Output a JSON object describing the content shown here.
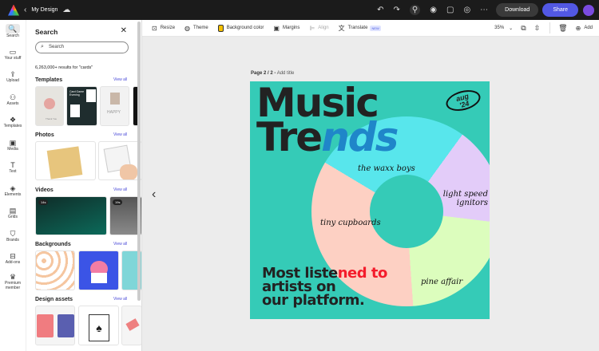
{
  "topbar": {
    "title": "My Design",
    "download": "Download",
    "share": "Share"
  },
  "rail": [
    {
      "icon": "search-icon",
      "glyph": "🔍",
      "label": "Search"
    },
    {
      "icon": "folder-icon",
      "glyph": "▭",
      "label": "Your stuff"
    },
    {
      "icon": "upload-icon",
      "glyph": "⇪",
      "label": "Upload"
    },
    {
      "icon": "assets-icon",
      "glyph": "⚇",
      "label": "Assets"
    },
    {
      "icon": "templates-icon",
      "glyph": "❖",
      "label": "Templates"
    },
    {
      "icon": "media-icon",
      "glyph": "▣",
      "label": "Media"
    },
    {
      "icon": "text-icon",
      "glyph": "T",
      "label": "Text"
    },
    {
      "icon": "elements-icon",
      "glyph": "◈",
      "label": "Elements"
    },
    {
      "icon": "grids-icon",
      "glyph": "▤",
      "label": "Grids"
    },
    {
      "icon": "brands-icon",
      "glyph": "⛉",
      "label": "Brands"
    },
    {
      "icon": "addons-icon",
      "glyph": "⊟",
      "label": "Add-ons"
    },
    {
      "icon": "premium-icon",
      "glyph": "♛",
      "label": "Premium member"
    }
  ],
  "panel": {
    "title": "Search",
    "search_placeholder": "Search",
    "results": "6,263,000+ results for \"cards\"",
    "view_all": "View all",
    "sections": [
      "Templates",
      "Photos",
      "Videos",
      "Backgrounds",
      "Design assets"
    ],
    "video_durations": [
      "14s",
      "19s"
    ],
    "template_text": [
      "Thank You",
      "Card Game Evening",
      "HAPPY"
    ]
  },
  "toolbar": {
    "resize": "Resize",
    "theme": "Theme",
    "bg": "Background color",
    "margins": "Margins",
    "align": "Align",
    "translate": "Translate",
    "new": "NEW",
    "zoom": "35%",
    "add": "Add"
  },
  "page": {
    "label": "Page 2 / 2 -",
    "add_title": "Add title"
  },
  "design": {
    "title1": "Music",
    "title2a": "Tre",
    "title2b": "nds",
    "badge1": "aug",
    "badge2": "'24",
    "slices": [
      "the waxx boys",
      "light speed ignitors",
      "pine affair",
      "tiny cupboards"
    ],
    "most_a": "Most liste",
    "most_b": "ned to",
    "line2": "artists on",
    "line3": "our platform.",
    "colors": {
      "bg": "#35cbb7",
      "cyan": "#58e6ec",
      "lavender": "#e3ccf9",
      "green": "#dcfdbd",
      "pink": "#fdd0c3",
      "red": "#f41c2c"
    }
  }
}
